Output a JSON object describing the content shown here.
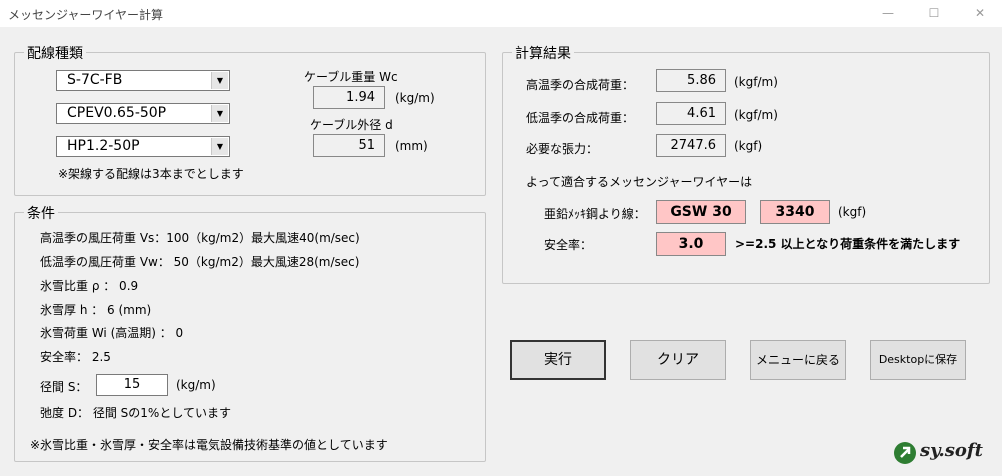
{
  "window": {
    "title": "メッセンジャーワイヤー計算",
    "minimize": "—",
    "maximize": "☐",
    "close": "✕"
  },
  "wiring": {
    "group_label": "配線種類",
    "combos": [
      "S-7C-FB",
      "CPEV0.65-50P",
      "HP1.2-50P"
    ],
    "note": "※架線する配線は3本までとします",
    "weight_label": "ケーブル重量 Wc",
    "weight_value": "1.94",
    "weight_unit": "(kg/m)",
    "diameter_label": "ケーブル外径 d",
    "diameter_value": "51",
    "diameter_unit": "(mm)"
  },
  "conditions": {
    "group_label": "条件",
    "line1": "高温季の風圧荷重 Vs：100（kg/m2）最大風速40(m/sec)",
    "line2": "低温季の風圧荷重 Vw：  50（kg/m2）最大風速28(m/sec)",
    "line3": "氷雪比重 ρ ： 0.9",
    "line4": "氷雪厚 h ：    6 (mm)",
    "line5": "氷雪荷重 Wi (高温期) ： 0",
    "line6": "安全率：  2.5",
    "span_label": "径間 S：",
    "span_value": "15",
    "span_unit": "(kg/m)",
    "sag_text": "弛度 D： 径間 Sの1%としています",
    "footnote": "※氷雪比重・氷雪厚・安全率は電気設備技術基準の値としています"
  },
  "results": {
    "group_label": "計算結果",
    "high_label": "高温季の合成荷重：",
    "high_value": "5.86",
    "high_unit": "(kgf/m)",
    "low_label": "低温季の合成荷重：",
    "low_value": "4.61",
    "low_unit": "(kgf/m)",
    "tension_label": "必要な張力：",
    "tension_value": "2747.6",
    "tension_unit": "(kgf)",
    "conclusion": "よって適合するメッセンジャーワイヤーは",
    "wire_label": "亜鉛ﾒｯｷ鋼より線：",
    "wire_value": "GSW 30",
    "wire_strength": "3340",
    "wire_unit": "(kgf)",
    "safety_label": "安全率：",
    "safety_value": "3.0",
    "safety_note": ">=2.5  以上となり荷重条件を満たします"
  },
  "buttons": {
    "run": "実行",
    "clear": "クリア",
    "menu": "メニューに戻る",
    "save": "Desktopに保存"
  },
  "logo": {
    "text": "sy.soft"
  },
  "colors": {
    "highlight": "#ffc6c6",
    "logo_green": "#2e7d32"
  }
}
